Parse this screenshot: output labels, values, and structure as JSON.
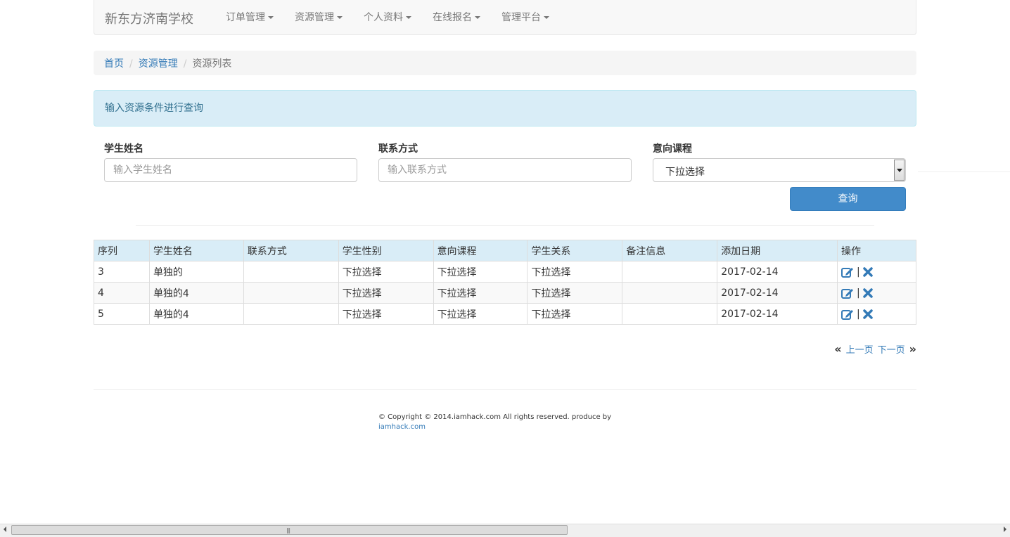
{
  "navbar": {
    "brand": "新东方济南学校",
    "items": [
      {
        "label": "订单管理"
      },
      {
        "label": "资源管理"
      },
      {
        "label": "个人资料"
      },
      {
        "label": "在线报名"
      },
      {
        "label": "管理平台"
      }
    ]
  },
  "breadcrumb": {
    "home": "首页",
    "section": "资源管理",
    "current": "资源列表",
    "separator": "/"
  },
  "alert": {
    "text": "输入资源条件进行查询"
  },
  "form": {
    "name": {
      "label": "学生姓名",
      "placeholder": "输入学生姓名"
    },
    "contact": {
      "label": "联系方式",
      "placeholder": "输入联系方式"
    },
    "course": {
      "label": "意向课程",
      "selected": "下拉选择"
    },
    "submit_label": "查询"
  },
  "table": {
    "headers": [
      "序列",
      "学生姓名",
      "联系方式",
      "学生性别",
      "意向课程",
      "学生关系",
      "备注信息",
      "添加日期",
      "操作"
    ],
    "rows": [
      {
        "id": "3",
        "name": "单独的",
        "contact": "",
        "gender": "下拉选择",
        "course": "下拉选择",
        "relation": "下拉选择",
        "note": "",
        "date": "2017-02-14"
      },
      {
        "id": "4",
        "name": "单独的4",
        "contact": "",
        "gender": "下拉选择",
        "course": "下拉选择",
        "relation": "下拉选择",
        "note": "",
        "date": "2017-02-14"
      },
      {
        "id": "5",
        "name": "单独的4",
        "contact": "",
        "gender": "下拉选择",
        "course": "下拉选择",
        "relation": "下拉选择",
        "note": "",
        "date": "2017-02-14"
      }
    ],
    "op_separator": "|",
    "icons": {
      "edit": "edit-icon",
      "delete": "delete-icon"
    }
  },
  "pager": {
    "prev": "上一页",
    "next": "下一页"
  },
  "footer": {
    "copyright": "© Copyright © 2014.iamhack.com All rights reserved. produce by",
    "link": "iamhack.com"
  },
  "colors": {
    "accent": "#337ab7",
    "button": "#428bca",
    "header_bg": "#d9edf7",
    "navbar_bg": "#f8f8f8"
  }
}
